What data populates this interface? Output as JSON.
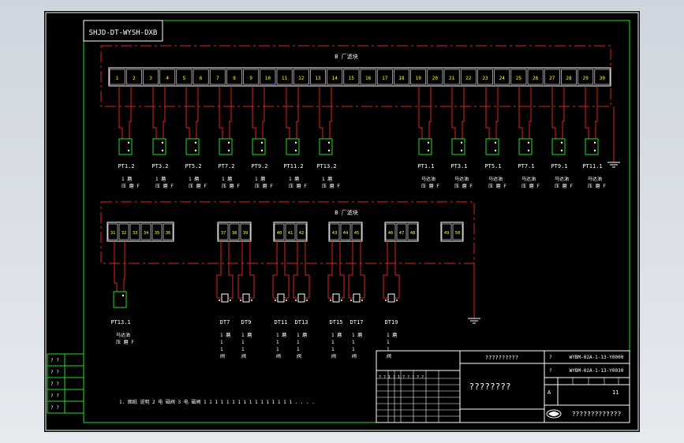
{
  "drawing_id": "SHJD-DT-WYSH-DXB",
  "box_a": {
    "label": "B  厂滤块",
    "terminals": [
      "1",
      "2",
      "3",
      "4",
      "5",
      "6",
      "7",
      "8",
      "9",
      "10",
      "11",
      "12",
      "13",
      "14",
      "15",
      "16",
      "17",
      "18",
      "19",
      "20",
      "21",
      "22",
      "23",
      "24",
      "25",
      "26",
      "27",
      "28",
      "29",
      "30"
    ]
  },
  "box_b": {
    "label": "B  厂滤块",
    "groups": [
      [
        "31",
        "32",
        "33",
        "34",
        "35",
        "36"
      ],
      [
        "37",
        "38",
        "39"
      ],
      [
        "40",
        "41",
        "42"
      ],
      [
        "43",
        "44",
        "45"
      ],
      [
        "46",
        "47",
        "48"
      ],
      [
        "49",
        "50"
      ]
    ]
  },
  "sensors_top": [
    {
      "tag": "PT1.2",
      "desc": "1 磨\n压 磨 F"
    },
    {
      "tag": "PT3.2",
      "desc": "1 磨\n压 磨 F"
    },
    {
      "tag": "PT5.2",
      "desc": "1 磨\n压 磨 F"
    },
    {
      "tag": "PT7.2",
      "desc": "1 磨\n压 磨 F"
    },
    {
      "tag": "PT9.2",
      "desc": "1 磨\n压 磨 F"
    },
    {
      "tag": "PT11.2",
      "desc": "1 磨\n压 磨 F"
    },
    {
      "tag": "PT13.2",
      "desc": "1 磨\n压 磨 F"
    },
    {
      "tag": "PT1.1",
      "desc": "马达油\n压 磨 F"
    },
    {
      "tag": "PT3.1",
      "desc": "马达油\n压 磨 F"
    },
    {
      "tag": "PT5.1",
      "desc": "马达油\n压 磨 F"
    },
    {
      "tag": "PT7.1",
      "desc": "马达油\n压 磨 F"
    },
    {
      "tag": "PT9.1",
      "desc": "马达油\n压 磨 F"
    },
    {
      "tag": "PT11.1",
      "desc": "马达油\n压 磨 F"
    }
  ],
  "sensors_bottom": [
    {
      "tag": "PT13.1",
      "desc": "马达油\n压 磨 F"
    },
    {
      "tag": "DT7",
      "desc": "1 磨\n1\n1\n阀"
    },
    {
      "tag": "DT9",
      "desc": "1 磨\n1\n1\n阀"
    },
    {
      "tag": "DT11",
      "desc": "1 磨\n1\n1\n阀"
    },
    {
      "tag": "DT13",
      "desc": "1 磨\n1\n1\n阀"
    },
    {
      "tag": "DT15",
      "desc": "1 磨\n1\n1\n阀"
    },
    {
      "tag": "DT17",
      "desc": "1 磨\n1\n1\n阀"
    },
    {
      "tag": "DT19",
      "desc": "1 磨\n1\n1\n阀"
    }
  ],
  "footnote": "1. 图纸 说明 2 电 磁阀 3 电 磁阀 1 1 1 1 1 1 1 1 1 1 1 1 1 1 1 1 . . . .",
  "revision_cells": [
    "? ?",
    "? ?",
    "? ?",
    "? ?",
    "? ?"
  ],
  "title_block": {
    "header": "??????????",
    "main_title": "????????",
    "company": "?????????????",
    "drawing_no_1": "WYBM-02A-1-13-Y0000",
    "drawing_no_2": "WYBM-02A-1-13-Y0030",
    "left_row_label": "? ? 1 ? 1 ? ? ? ? ?",
    "grid_mark": "?",
    "scale_label": "A",
    "sheet": "11"
  }
}
